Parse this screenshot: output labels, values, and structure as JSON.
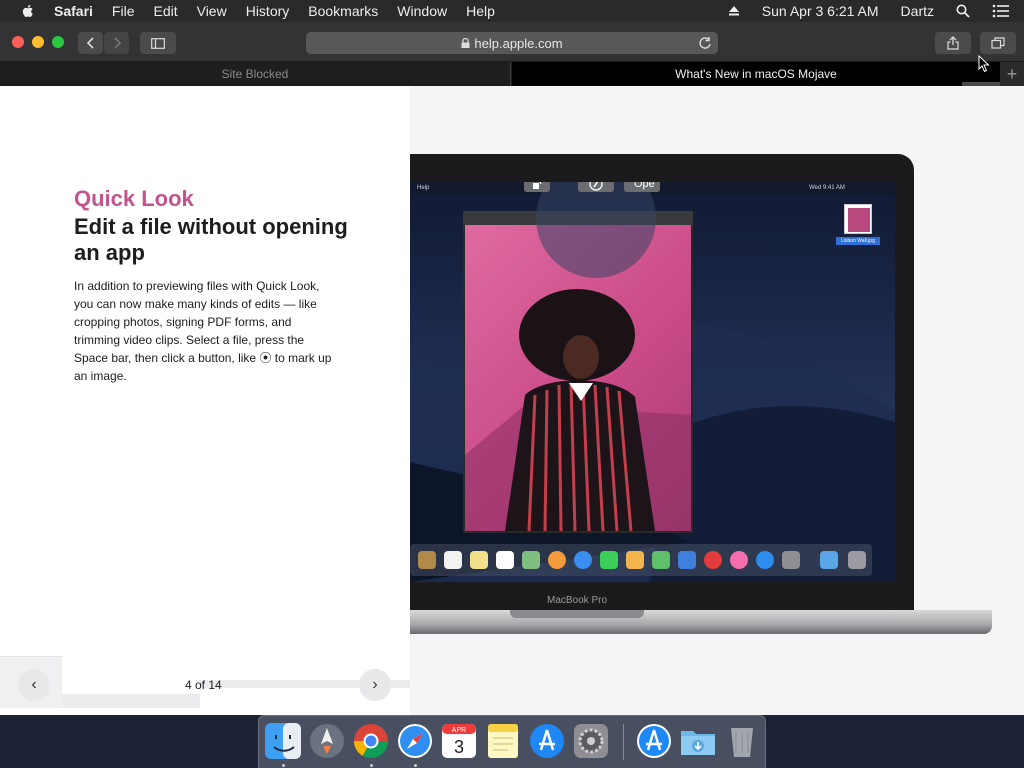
{
  "menubar": {
    "app": "Safari",
    "items": [
      "File",
      "Edit",
      "View",
      "History",
      "Bookmarks",
      "Window",
      "Help"
    ],
    "datetime": "Sun Apr 3  6:21 AM",
    "user": "Dartz"
  },
  "toolbar": {
    "address": "help.apple.com"
  },
  "tabs": [
    {
      "label": "Site Blocked",
      "active": false
    },
    {
      "label": "What's New in macOS Mojave",
      "active": true
    }
  ],
  "newtab_label": "+",
  "article": {
    "eyebrow": "Quick Look",
    "headline": "Edit a file without opening an app",
    "body": "In addition to previewing files with Quick Look, you can now make many kinds of edits — like cropping photos, signing PDF forms, and trimming video clips. Select a file, press the Space bar, then click a button, like ⦿ to mark up an image.",
    "accent_color": "#c3558e"
  },
  "pager": {
    "text": "4 of 14",
    "prev": "‹",
    "next": "›"
  },
  "illustration": {
    "screen_menu_left": "Help",
    "screen_menu_right": "Wed 9:41 AM",
    "open_button": "Ope",
    "desktop_file": "Lisbon Wall.jpg",
    "laptop_label": "MacBook Pro"
  },
  "dock": {
    "apps": [
      "finder-icon",
      "launchpad-icon",
      "chrome-icon",
      "safari-icon",
      "calendar-icon",
      "notes-icon",
      "app-store-icon",
      "system-preferences-icon",
      "app-store-icon",
      "downloads-folder-icon",
      "trash-icon"
    ],
    "calendar_month": "APR",
    "calendar_day": "3"
  }
}
